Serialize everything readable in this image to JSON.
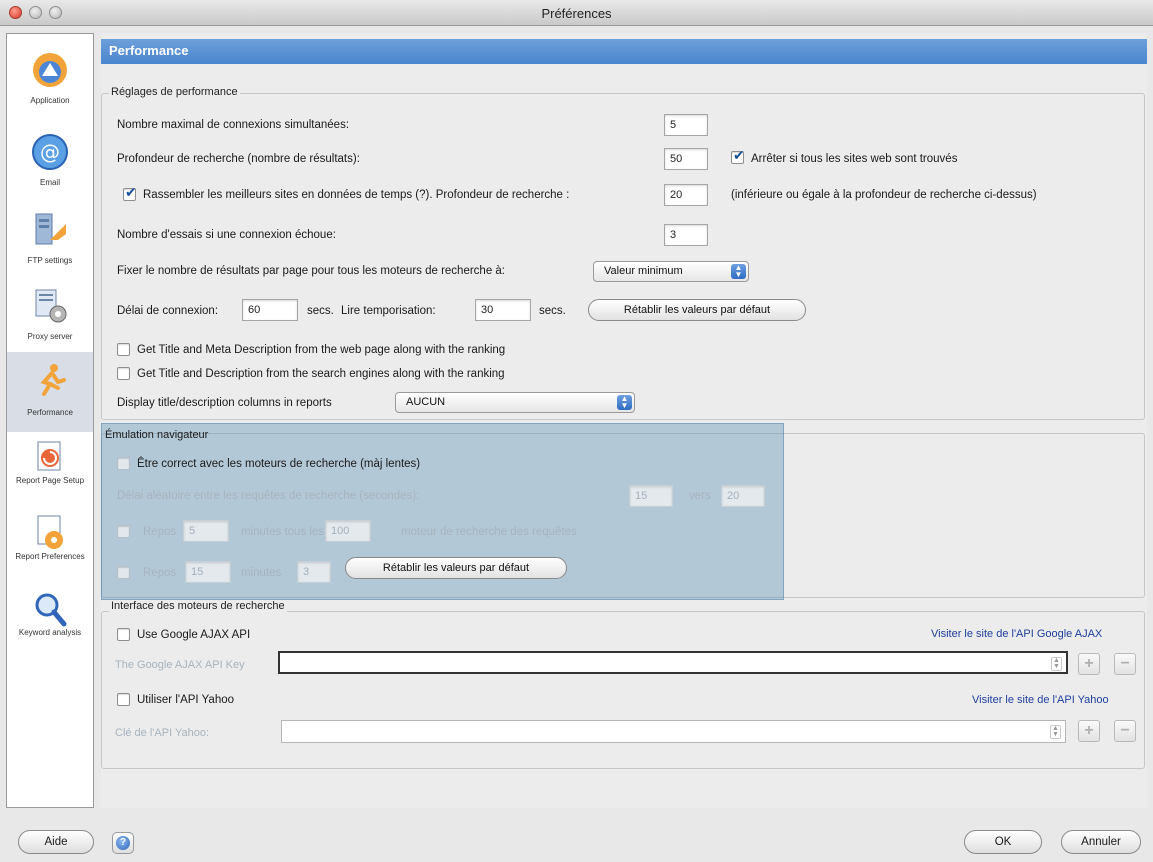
{
  "window": {
    "title": "Préférences"
  },
  "sidebar": {
    "items": [
      {
        "label": "Application",
        "icon": "application-icon"
      },
      {
        "label": "Email",
        "icon": "email-icon"
      },
      {
        "label": "FTP settings",
        "icon": "ftp-icon"
      },
      {
        "label": "Proxy server",
        "icon": "proxy-icon"
      },
      {
        "label": "Performance",
        "icon": "performance-icon"
      },
      {
        "label": "Report Page Setup",
        "icon": "report-page-icon"
      },
      {
        "label": "Report Preferences",
        "icon": "report-preferences-icon"
      },
      {
        "label": "Keyword analysis",
        "icon": "keyword-icon"
      }
    ],
    "active": "Performance"
  },
  "header": {
    "title": "Performance"
  },
  "perf": {
    "group_title": "Réglages de performance",
    "max_conn_label": "Nombre maximal de connexions simultanées:",
    "max_conn_value": "5",
    "depth_label": "Profondeur de recherche (nombre de résultats):",
    "depth_value": "50",
    "stop_label": "Arrêter si tous les sites web sont trouvés",
    "gather_label": "Rassembler les meilleurs sites en données de temps (?). Profondeur de recherche :",
    "gather_value": "20",
    "gather_hint": "(inférieure ou égale à la profondeur de recherche ci-dessus)",
    "retries_label": "Nombre d'essais si une connexion échoue:",
    "retries_value": "3",
    "results_label": "Fixer le nombre de résultats par page pour tous les moteurs de recherche à:",
    "results_value": "Valeur minimum",
    "conn_delay_label": "Délai de connexion:",
    "conn_delay_value": "60",
    "secs1": "secs.",
    "read_timeout_label": "Lire temporisation:",
    "read_timeout_value": "30",
    "secs2": "secs.",
    "reset_label": "Rétablir les valeurs par défaut",
    "meta_label": "Get Title and Meta Description from the web page along with the ranking",
    "desc_label": "Get Title and Description from the search engines along with the ranking",
    "display_cols_label": "Display title/description columns in reports",
    "display_cols_value": "AUCUN"
  },
  "emulation": {
    "group_title": "Émulation navigateur",
    "correct_label": "Être correct avec les moteurs de recherche (màj lentes)",
    "delay_label": "Délai aléatoire entre les requêtes de recherche (secondes):",
    "delay_from": "15",
    "delay_to_label": "vers",
    "delay_to": "20",
    "rest1_label": "Repos",
    "rest1_value": "5",
    "rest1_mid": "minutes tous les",
    "rest1_count": "100",
    "rest1_end": "moteur de recherche des requêtes",
    "rest2_label": "Repos",
    "rest2_value": "15",
    "rest2_mid": "minutes",
    "rest2_count": "3",
    "reset_label": "Rétablir les valeurs par défaut"
  },
  "engines": {
    "group_title": "Interface des moteurs de recherche",
    "google_label": "Use Google AJAX API",
    "google_link": "Visiter le site de l'API Google AJAX",
    "google_key_label": "The Google AJAX API Key",
    "yahoo_label": "Utiliser l'API Yahoo",
    "yahoo_link": "Visiter le site de l'API Yahoo",
    "yahoo_key_label": "Clé de l'API Yahoo:"
  },
  "footer": {
    "help_label": "Aide",
    "ok_label": "OK",
    "cancel_label": "Annuler"
  }
}
